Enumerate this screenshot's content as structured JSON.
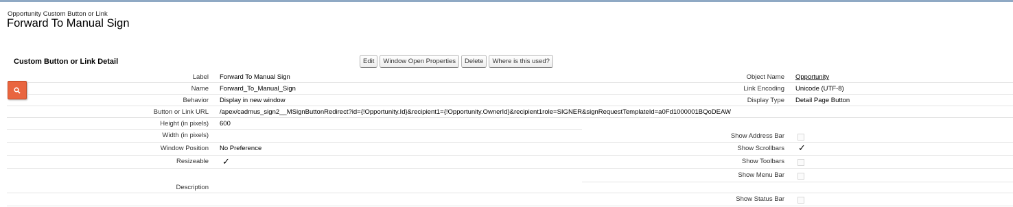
{
  "page": {
    "breadcrumb": "Opportunity Custom Button or Link",
    "title": "Forward To Manual Sign"
  },
  "detail": {
    "section_title": "Custom Button or Link Detail",
    "buttons": {
      "edit": "Edit",
      "window_open_properties": "Window Open Properties",
      "delete": "Delete",
      "where_used": "Where is this used?"
    },
    "fields": {
      "label": {
        "label": "Label",
        "value": "Forward To Manual Sign"
      },
      "name": {
        "label": "Name",
        "value": "Forward_To_Manual_Sign"
      },
      "behavior": {
        "label": "Behavior",
        "value": "Display in new window"
      },
      "url": {
        "label": "Button or Link URL",
        "value": "/apex/cadmus_sign2__MSignButtonRedirect?id={!Opportunity.Id}&recipient1={!Opportunity.OwnerId}&recipient1role=SIGNER&signRequestTemplateId=a0Fd1000001BQoDEAW"
      },
      "height": {
        "label": "Height (in pixels)",
        "value": "600"
      },
      "width": {
        "label": "Width (in pixels)",
        "value": ""
      },
      "window_position": {
        "label": "Window Position",
        "value": "No Preference"
      },
      "resizeable": {
        "label": "Resizeable",
        "checked": true
      },
      "description": {
        "label": "Description",
        "value": ""
      },
      "object_name": {
        "label": "Object Name",
        "value": "Opportunity"
      },
      "link_encoding": {
        "label": "Link Encoding",
        "value": "Unicode (UTF-8)"
      },
      "display_type": {
        "label": "Display Type",
        "value": "Detail Page Button"
      },
      "show_address_bar": {
        "label": "Show Address Bar",
        "checked": false
      },
      "show_scrollbars": {
        "label": "Show Scrollbars",
        "checked": true
      },
      "show_toolbars": {
        "label": "Show Toolbars",
        "checked": false
      },
      "show_menu_bar": {
        "label": "Show Menu Bar",
        "checked": false
      },
      "show_status_bar": {
        "label": "Show Status Bar",
        "checked": false
      }
    },
    "check_glyph": "✓"
  },
  "icons": {
    "search_tab": "search-icon"
  },
  "colors": {
    "search_tab_bg": "#e9653f",
    "top_bar": "#8fa9c4"
  }
}
